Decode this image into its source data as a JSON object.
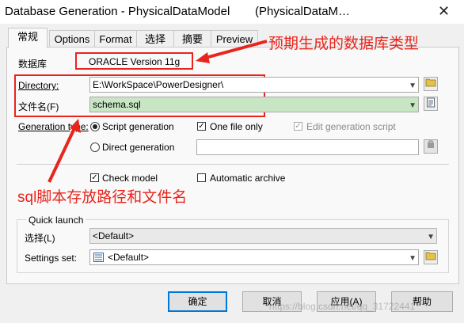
{
  "window": {
    "title": "Database Generation - PhysicalDataModel",
    "subtitle": "(PhysicalDataM…",
    "close_glyph": "✕"
  },
  "tabs": [
    "常规",
    "Options",
    "Format",
    "选择",
    "摘要",
    "Preview"
  ],
  "general": {
    "dbms_label": "数据库",
    "dbms_value": "ORACLE Version 11g",
    "directory_label": "Directory:",
    "directory_value": "E:\\WorkSpace\\PowerDesigner\\",
    "filename_label": "文件名(F)",
    "filename_value": "schema.sql",
    "generation_type_label": "Generation type:",
    "script_generation": "Script generation",
    "direct_generation": "Direct generation",
    "one_file_only": "One file only",
    "edit_generation_script": "Edit generation script",
    "check_model": "Check model",
    "automatic_archive": "Automatic archive"
  },
  "quick_launch": {
    "title": "Quick launch",
    "selection_label": "选择(L)",
    "selection_value": "<Default>",
    "settings_label": "Settings set:",
    "settings_value": "<Default>"
  },
  "buttons": {
    "ok": "确定",
    "cancel": "取消",
    "apply": "应用(A)",
    "help": "帮助"
  },
  "annotations": {
    "dbms_note": "预期生成的数据库类型",
    "path_note": "sql脚本存放路径和文件名"
  },
  "watermark": "https://blog.csdn.net/qq_31722441",
  "colors": {
    "annotation_red": "#e8251c",
    "filename_highlight": "#c8e6c4"
  }
}
